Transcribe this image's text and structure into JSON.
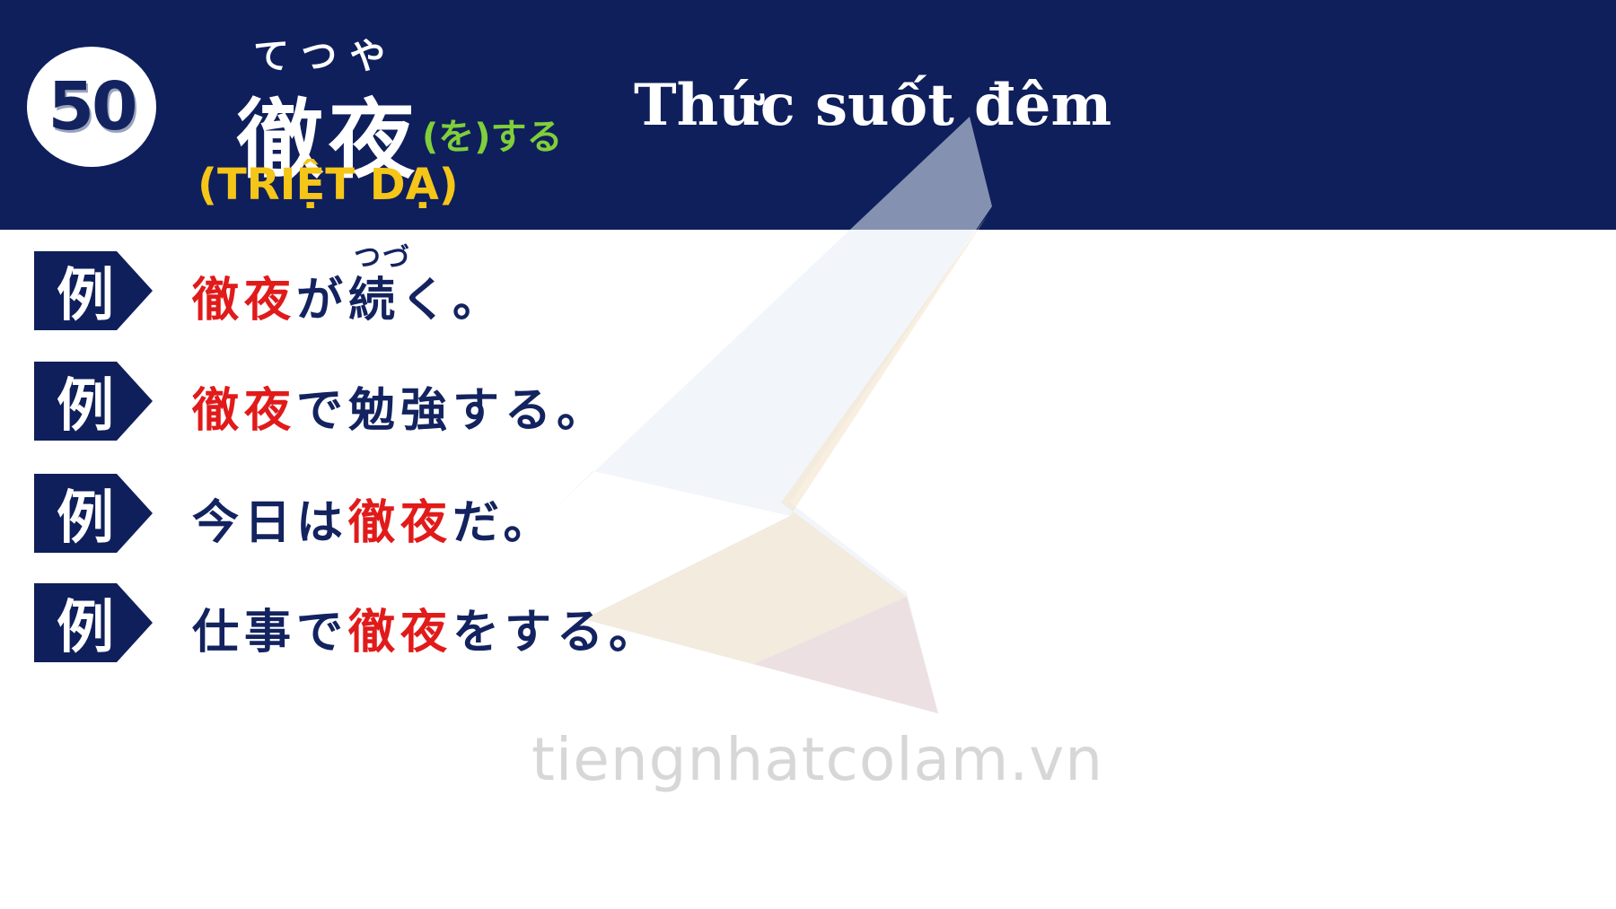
{
  "header": {
    "number": "50",
    "furigana": "てつや",
    "kanji": "徹夜",
    "suffix": "(を)する",
    "reading": "(TRIỆT DẠ)",
    "meaning": "Thức suốt đêm"
  },
  "tag_label": "例",
  "examples": [
    {
      "ruby": "つづ",
      "parts": [
        {
          "text": "徹夜",
          "hl": true
        },
        {
          "text": "が",
          "hl": false
        },
        {
          "text": "続く。",
          "hl": false
        }
      ]
    },
    {
      "parts": [
        {
          "text": "徹夜",
          "hl": true
        },
        {
          "text": "で勉強する。",
          "hl": false
        }
      ]
    },
    {
      "parts": [
        {
          "text": "今日は",
          "hl": false
        },
        {
          "text": "徹夜",
          "hl": true
        },
        {
          "text": "だ。",
          "hl": false
        }
      ]
    },
    {
      "parts": [
        {
          "text": "仕事で",
          "hl": false
        },
        {
          "text": "徹夜",
          "hl": true
        },
        {
          "text": "をする。",
          "hl": false
        }
      ]
    }
  ],
  "watermark": "tiengnhatcolam.vn",
  "colors": {
    "header_bg": "#0f1f5c",
    "highlight": "#e11a1a",
    "text_dark": "#13235f",
    "reading": "#f5c518",
    "suffix": "#7fcf3a"
  }
}
